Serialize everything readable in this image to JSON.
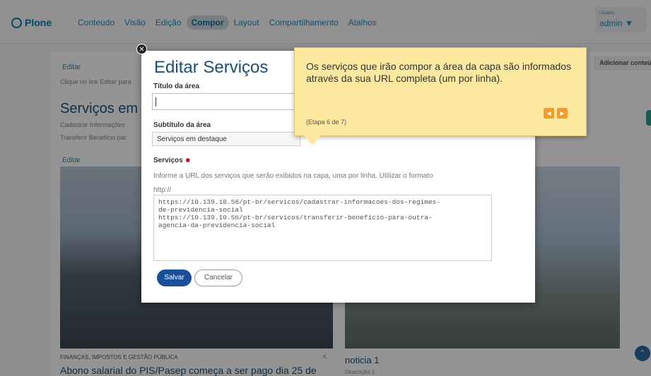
{
  "toolbar": {
    "logo": "Plone",
    "menu": [
      "Conteudo",
      "Visão",
      "Edição",
      "Compor",
      "Layout",
      "Compartilhamento",
      "Atalhos"
    ],
    "active_menu": "Compor",
    "user_small": "Usuário",
    "user_name": "admin ▼"
  },
  "page": {
    "edit_top": "Editar",
    "edit_hint": "Clique no link Editar para",
    "big_title": "Serviços em",
    "line1": "Cadastrar Informações",
    "line2": "Transferir Benefício par",
    "edit_mid": "Editar",
    "add_content": "Adicionar conteúdo",
    "category": "FINANÇAS, IMPOSTOS E GESTÃO PÚBLICA",
    "headline": "Abono salarial do PIS/Pasep começa a ser pago dia 25 de",
    "noticia": "noticia 1",
    "noticia_sub": "Descrição 1"
  },
  "modal": {
    "title": "Editar Serviços",
    "titulo_label": "Título da área",
    "titulo_value": "",
    "subtitulo_label": "Subtítulo da área",
    "subtitulo_value": "Serviços em destaque",
    "servicos_label": "Serviços",
    "required_mark": "■",
    "servicos_help_1": "Informe a URL dos serviços que serão exibidos na capa, uma por linha. Utilizar o formato",
    "servicos_help_2": "http://",
    "servicos_value": "https://10.139.10.56/pt-br/servicos/cadastrar-informacoes-dos-regimes-\nde-previdencia-social\nhttps://10.139.10.56/pt-br/servicos/transferir-beneficio-para-outra-\nagencia-da-previdencia-social",
    "save": "Salvar",
    "cancel": "Cancelar"
  },
  "tooltip": {
    "text": "Os serviços que irão compor a área da capa são informados através da sua URL completa (um por linha).",
    "step": "(Etapa 6 de 7)",
    "prev": "◀",
    "next": "▶"
  },
  "colors": {
    "brand": "#007bb1",
    "title": "#1a4f78",
    "save_button": "#1a4f9a",
    "tooltip_bg": "#fde8a0",
    "tooltip_nav": "#f39c28"
  }
}
